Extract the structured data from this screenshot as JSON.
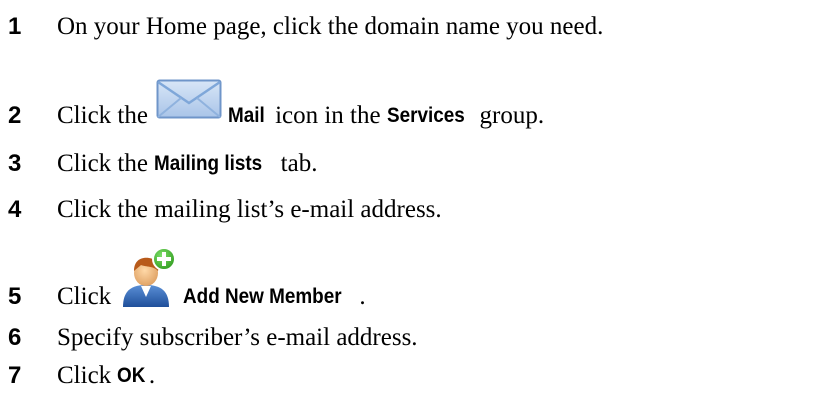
{
  "steps": [
    {
      "num": "1",
      "before": "On your Home page, click the domain name you need."
    },
    {
      "num": "2",
      "before": "Click the",
      "icon": "mail-icon",
      "ui": "Mail",
      "after": " icon in the ",
      "ui2": "Services",
      "after2": " group."
    },
    {
      "num": "3",
      "before": "Click the ",
      "ui": "Mailing lists",
      "after": " tab."
    },
    {
      "num": "4",
      "before": "Click the mailing list’s e-mail address."
    },
    {
      "num": "5",
      "before": "Click",
      "icon": "add-user-icon",
      "ui": "Add New Member",
      "after": "."
    },
    {
      "num": "6",
      "before": "Specify subscriber’s e-mail address."
    },
    {
      "num": "7",
      "before": "Click ",
      "ui": "OK",
      "after": "."
    }
  ],
  "colors": {
    "text": "#000000",
    "background": "#ffffff",
    "mail_icon_blue": "#7fa7d9",
    "add_icon_green": "#3fae2a"
  }
}
